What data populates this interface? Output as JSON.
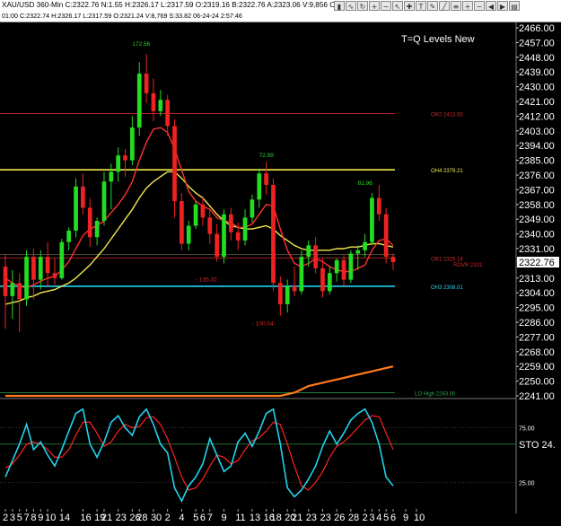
{
  "header": {
    "title_line": "XAU/USD 360-Min   C:2322.76  N:1.55  H:2326.17  L:2317.59  O:2319.16  B:2322.76  A:2323.06  V:9,856  OI",
    "ohlc_line": "01:00  C:2322.74  H:2326.17  L:2317.59  O:2321.24  V:8,769  S:33.82  06-24-24  2:57:46",
    "toolbar_icons": [
      "bar-chart-icon",
      "line-chart-icon",
      "refresh-icon",
      "zoom-in-icon",
      "zoom-out-icon",
      "cursor-icon",
      "crosshair-icon",
      "text-icon",
      "pen-icon",
      "trendline-icon",
      "fib-icon",
      "plus-icon",
      "minus-icon",
      "scroll-left-icon",
      "scroll-right-icon",
      "menu-icon"
    ],
    "toolbar_glyphs": [
      "▮",
      "∿",
      "↻",
      "+",
      "−",
      "↖",
      "✚",
      "T",
      "✎",
      "╱",
      "≡",
      "+",
      "−",
      "◀",
      "▶",
      "▤"
    ]
  },
  "colors": {
    "background": "#000000",
    "candle_up": "#22dd22",
    "candle_down": "#ee2222",
    "sma_slow": "#ff7a1a",
    "ema_mid": "#f2e94e",
    "ema_fast": "#ff3030",
    "level_yellow": "#f2e94e",
    "level_cyan": "#22d3ee",
    "level_red": "#cc2a2a",
    "level_green": "#2fa84f",
    "price_box": "#ffffff",
    "sto_k": "#22d3ee",
    "sto_d": "#ff2222"
  },
  "chart_data": {
    "type": "candlestick",
    "title": "T=Q Levels New",
    "price_axis": {
      "ticks": [
        2466.0,
        2457.0,
        2448.0,
        2439.0,
        2430.0,
        2421.0,
        2412.0,
        2403.0,
        2394.0,
        2385.0,
        2376.0,
        2367.0,
        2358.0,
        2349.0,
        2340.0,
        2331.0,
        2322.76,
        2313.0,
        2304.0,
        2295.0,
        2286.0,
        2277.0,
        2268.0,
        2259.0,
        2250.0,
        2241.0
      ],
      "tick_labels": [
        "2466.00",
        "2457.00",
        "2448.00",
        "2439.00",
        "2430.00",
        "2421.00",
        "2412.00",
        "2403.00",
        "2394.00",
        "2385.00",
        "2376.00",
        "2367.00",
        "2358.00",
        "2349.00",
        "2340.00",
        "2331.00",
        "2322.76",
        "2313.00",
        "2304.00",
        "2295.00",
        "2286.00",
        "2277.00",
        "2268.00",
        "2259.00",
        "2250.00",
        "2241.00"
      ],
      "range": [
        2241,
        2466
      ],
      "current": 2322.76,
      "current_label": "2322.76"
    },
    "x_axis": {
      "labels": [
        "2",
        "3",
        "5",
        "7",
        "8",
        "9",
        "10",
        "14",
        "16",
        "19",
        "21",
        "23",
        "26",
        "28",
        "30",
        "2",
        "4",
        "5",
        "6",
        "7",
        "9",
        "11",
        "13",
        "16",
        "18",
        "20",
        "21",
        "23",
        "23",
        "26",
        "28",
        "2",
        "3",
        "4",
        "5",
        "6",
        "9",
        "10"
      ],
      "label_candle_index": [
        0,
        1,
        2,
        3,
        4,
        5,
        6,
        8,
        11,
        13,
        14,
        16,
        18,
        19,
        21,
        23,
        25,
        27,
        28,
        29,
        31,
        33,
        35,
        37,
        38,
        40,
        41,
        43,
        45,
        47,
        49,
        51,
        52,
        53,
        54,
        55,
        56,
        57
      ]
    },
    "candles": [
      {
        "o": 2320,
        "h": 2327,
        "l": 2282,
        "c": 2302
      },
      {
        "o": 2302,
        "h": 2318,
        "l": 2288,
        "c": 2310
      },
      {
        "o": 2310,
        "h": 2316,
        "l": 2280,
        "c": 2300
      },
      {
        "o": 2300,
        "h": 2330,
        "l": 2296,
        "c": 2326
      },
      {
        "o": 2326,
        "h": 2331,
        "l": 2300,
        "c": 2312
      },
      {
        "o": 2312,
        "h": 2330,
        "l": 2306,
        "c": 2326
      },
      {
        "o": 2326,
        "h": 2335,
        "l": 2308,
        "c": 2316
      },
      {
        "o": 2316,
        "h": 2325,
        "l": 2309,
        "c": 2313
      },
      {
        "o": 2313,
        "h": 2337,
        "l": 2312,
        "c": 2335
      },
      {
        "o": 2335,
        "h": 2344,
        "l": 2330,
        "c": 2342
      },
      {
        "o": 2342,
        "h": 2374,
        "l": 2338,
        "c": 2369
      },
      {
        "o": 2369,
        "h": 2377,
        "l": 2352,
        "c": 2356
      },
      {
        "o": 2356,
        "h": 2362,
        "l": 2332,
        "c": 2338
      },
      {
        "o": 2338,
        "h": 2350,
        "l": 2333,
        "c": 2348
      },
      {
        "o": 2348,
        "h": 2378,
        "l": 2345,
        "c": 2372
      },
      {
        "o": 2372,
        "h": 2383,
        "l": 2355,
        "c": 2378
      },
      {
        "o": 2378,
        "h": 2393,
        "l": 2372,
        "c": 2388
      },
      {
        "o": 2388,
        "h": 2392,
        "l": 2375,
        "c": 2385
      },
      {
        "o": 2385,
        "h": 2412,
        "l": 2382,
        "c": 2405
      },
      {
        "o": 2405,
        "h": 2445,
        "l": 2400,
        "c": 2438
      },
      {
        "o": 2438,
        "h": 2450,
        "l": 2420,
        "c": 2426
      },
      {
        "o": 2426,
        "h": 2435,
        "l": 2409,
        "c": 2415
      },
      {
        "o": 2415,
        "h": 2428,
        "l": 2412,
        "c": 2422
      },
      {
        "o": 2422,
        "h": 2425,
        "l": 2400,
        "c": 2406
      },
      {
        "o": 2406,
        "h": 2410,
        "l": 2350,
        "c": 2360
      },
      {
        "o": 2360,
        "h": 2365,
        "l": 2330,
        "c": 2334
      },
      {
        "o": 2334,
        "h": 2348,
        "l": 2330,
        "c": 2345
      },
      {
        "o": 2345,
        "h": 2360,
        "l": 2343,
        "c": 2358
      },
      {
        "o": 2358,
        "h": 2363,
        "l": 2345,
        "c": 2350
      },
      {
        "o": 2350,
        "h": 2355,
        "l": 2334,
        "c": 2340
      },
      {
        "o": 2340,
        "h": 2346,
        "l": 2323,
        "c": 2326
      },
      {
        "o": 2326,
        "h": 2355,
        "l": 2322,
        "c": 2352
      },
      {
        "o": 2352,
        "h": 2356,
        "l": 2336,
        "c": 2341
      },
      {
        "o": 2341,
        "h": 2347,
        "l": 2330,
        "c": 2336
      },
      {
        "o": 2336,
        "h": 2355,
        "l": 2333,
        "c": 2350
      },
      {
        "o": 2350,
        "h": 2364,
        "l": 2347,
        "c": 2361
      },
      {
        "o": 2361,
        "h": 2380,
        "l": 2356,
        "c": 2377
      },
      {
        "o": 2377,
        "h": 2384,
        "l": 2364,
        "c": 2370
      },
      {
        "o": 2370,
        "h": 2374,
        "l": 2305,
        "c": 2310
      },
      {
        "o": 2310,
        "h": 2314,
        "l": 2290,
        "c": 2297
      },
      {
        "o": 2297,
        "h": 2312,
        "l": 2292,
        "c": 2308
      },
      {
        "o": 2308,
        "h": 2320,
        "l": 2302,
        "c": 2305
      },
      {
        "o": 2305,
        "h": 2330,
        "l": 2303,
        "c": 2326
      },
      {
        "o": 2326,
        "h": 2336,
        "l": 2320,
        "c": 2333
      },
      {
        "o": 2333,
        "h": 2338,
        "l": 2316,
        "c": 2319
      },
      {
        "o": 2319,
        "h": 2325,
        "l": 2301,
        "c": 2305
      },
      {
        "o": 2305,
        "h": 2320,
        "l": 2303,
        "c": 2316
      },
      {
        "o": 2316,
        "h": 2325,
        "l": 2311,
        "c": 2324
      },
      {
        "o": 2324,
        "h": 2327,
        "l": 2308,
        "c": 2312
      },
      {
        "o": 2312,
        "h": 2330,
        "l": 2310,
        "c": 2328
      },
      {
        "o": 2328,
        "h": 2333,
        "l": 2318,
        "c": 2330
      },
      {
        "o": 2330,
        "h": 2340,
        "l": 2326,
        "c": 2335
      },
      {
        "o": 2335,
        "h": 2365,
        "l": 2333,
        "c": 2362
      },
      {
        "o": 2362,
        "h": 2370,
        "l": 2348,
        "c": 2352
      },
      {
        "o": 2352,
        "h": 2356,
        "l": 2322,
        "c": 2326
      },
      {
        "o": 2326,
        "h": 2328,
        "l": 2318,
        "c": 2322.76
      }
    ],
    "series": [
      {
        "name": "",
        "color_key": "sma_slow",
        "values": [
          2241,
          2241,
          2241,
          2241,
          2241,
          2241,
          2241,
          2241,
          2241,
          2241,
          2241,
          2241,
          2241,
          2241,
          2241,
          2241,
          2241,
          2241,
          2241,
          2241,
          2241,
          2241,
          2241,
          2241,
          2241,
          2241,
          2241,
          2241,
          2241,
          2241,
          2241,
          2241,
          2241,
          2241,
          2241,
          2241,
          2241,
          2241,
          2241,
          2241,
          2242,
          2243,
          2245,
          2247,
          2248,
          2249,
          2250,
          2251,
          2252,
          2253,
          2254,
          2255,
          2256,
          2257,
          2258,
          2259
        ]
      },
      {
        "name": "",
        "color_key": "ema_mid",
        "values": [
          2297,
          2298,
          2299,
          2301,
          2302,
          2304,
          2305,
          2306,
          2308,
          2310,
          2313,
          2317,
          2321,
          2326,
          2331,
          2337,
          2343,
          2349,
          2355,
          2362,
          2368,
          2372,
          2375,
          2378,
          2378,
          2374,
          2369,
          2365,
          2362,
          2357,
          2352,
          2348,
          2345,
          2344,
          2343,
          2343,
          2344,
          2345,
          2343,
          2339,
          2336,
          2333,
          2331,
          2330,
          2330,
          2330,
          2330,
          2331,
          2331,
          2332,
          2332,
          2333,
          2334,
          2334,
          2333,
          2332
        ]
      },
      {
        "name": "",
        "color_key": "ema_fast",
        "values": [
          2313,
          2310,
          2308,
          2307,
          2309,
          2311,
          2313,
          2314,
          2318,
          2323,
          2331,
          2339,
          2343,
          2345,
          2348,
          2353,
          2358,
          2364,
          2372,
          2385,
          2396,
          2404,
          2405,
          2402,
          2392,
          2379,
          2366,
          2360,
          2357,
          2355,
          2350,
          2348,
          2347,
          2344,
          2344,
          2346,
          2352,
          2358,
          2357,
          2343,
          2330,
          2322,
          2320,
          2322,
          2325,
          2323,
          2320,
          2318,
          2317,
          2317,
          2319,
          2321,
          2330,
          2336,
          2337,
          2333
        ]
      }
    ],
    "levels": [
      {
        "price": 2413.55,
        "label": "OR2  2413.55",
        "color_key": "level_red"
      },
      {
        "price": 2379.21,
        "label": "OH4  2379.21",
        "color_key": "level_yellow"
      },
      {
        "price": 2325.18,
        "label": "OR1  2325.18",
        "color_key": "level_red"
      },
      {
        "price": 2308.01,
        "label": "OH3  2308.01",
        "color_key": "level_cyan"
      },
      {
        "price": 2243.0,
        "label": "LO High  2243.00",
        "color_key": "level_green"
      }
    ],
    "rover_label": "ROVR  2321",
    "annotations": [
      {
        "text": "172.56",
        "candle": 19,
        "price": 2455,
        "color_key": "candle_up"
      },
      {
        "text": "72.99",
        "candle": 37,
        "price": 2387,
        "color_key": "candle_up"
      },
      {
        "text": "81.96",
        "candle": 51,
        "price": 2370,
        "color_key": "candle_up"
      },
      {
        "text": "- 135.32",
        "candle": 28,
        "price": 2311,
        "color_key": "candle_down"
      },
      {
        "text": "- 100.04",
        "candle": 36,
        "price": 2284,
        "color_key": "candle_down"
      }
    ],
    "stochastic": {
      "label": "STO",
      "value_label": "24.",
      "ticks": [
        75,
        25
      ],
      "tick_labels": [
        "75.00",
        "25.00"
      ],
      "range": [
        0,
        100
      ],
      "k": [
        30,
        45,
        60,
        78,
        55,
        62,
        50,
        40,
        55,
        72,
        88,
        92,
        60,
        48,
        62,
        80,
        86,
        75,
        68,
        85,
        92,
        78,
        60,
        52,
        20,
        8,
        22,
        30,
        42,
        65,
        50,
        35,
        40,
        62,
        70,
        58,
        72,
        88,
        92,
        60,
        20,
        12,
        18,
        28,
        40,
        58,
        72,
        60,
        70,
        82,
        88,
        92,
        80,
        60,
        30,
        22
      ],
      "d": [
        38,
        42,
        50,
        60,
        62,
        60,
        55,
        48,
        48,
        55,
        68,
        80,
        80,
        70,
        58,
        62,
        72,
        78,
        75,
        76,
        84,
        85,
        78,
        65,
        48,
        30,
        18,
        20,
        28,
        40,
        50,
        48,
        42,
        45,
        55,
        63,
        66,
        72,
        80,
        78,
        60,
        40,
        22,
        18,
        25,
        35,
        48,
        58,
        62,
        68,
        75,
        82,
        86,
        85,
        70,
        55
      ]
    }
  }
}
